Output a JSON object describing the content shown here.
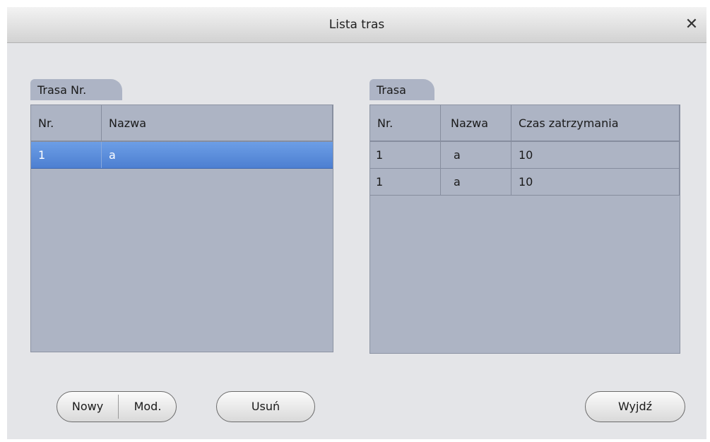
{
  "dialog": {
    "title": "Lista tras",
    "close_glyph": "✕"
  },
  "left_panel": {
    "tab_label": "Trasa Nr.",
    "columns": [
      "Nr.",
      "Nazwa"
    ],
    "rows": [
      {
        "nr": "1",
        "nazwa": "a",
        "selected": true
      }
    ]
  },
  "right_panel": {
    "tab_label": "Trasa",
    "columns": [
      "Nr.",
      "Nazwa",
      "Czas zatrzymania"
    ],
    "rows": [
      {
        "nr": "1",
        "nazwa": "a",
        "czas": "10"
      },
      {
        "nr": "1",
        "nazwa": "a",
        "czas": "10"
      }
    ]
  },
  "buttons": {
    "new_label": "Nowy",
    "modify_label": "Mod.",
    "delete_label": "Usuń",
    "exit_label": "Wyjdź"
  },
  "colors": {
    "selection": "#5585d6",
    "table_bg": "#adb4c4",
    "dialog_bg": "#e4e5e8"
  }
}
